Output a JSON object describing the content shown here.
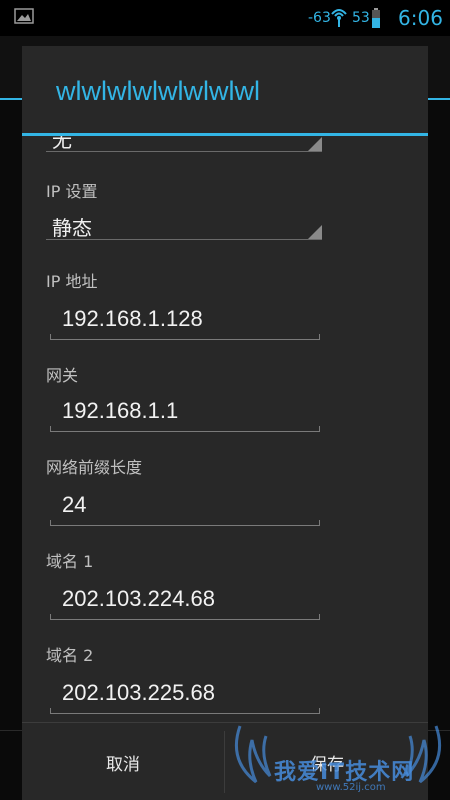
{
  "status_bar": {
    "signal": "-63",
    "battery": "53",
    "time": "6:06",
    "icons": [
      "image-icon",
      "wifi-icon",
      "battery-icon"
    ]
  },
  "dialog": {
    "title": "wlwlwlwlwlwlwlwl",
    "proxy_value": "无",
    "ip_settings_label": "IP 设置",
    "ip_settings_value": "静态",
    "ip_address_label": "IP 地址",
    "ip_address_value": "192.168.1.128",
    "gateway_label": "网关",
    "gateway_value": "192.168.1.1",
    "prefix_label": "网络前缀长度",
    "prefix_value": "24",
    "dns1_label": "域名 1",
    "dns1_value": "202.103.224.68",
    "dns2_label": "域名 2",
    "dns2_value": "202.103.225.68",
    "cancel_label": "取消",
    "save_label": "保存"
  },
  "watermark": {
    "text": "我爱IT技术网",
    "url": "www.52ij.com"
  },
  "colors": {
    "accent": "#33b5e5",
    "dialog_bg": "#282828",
    "text": "#f0f0f0"
  }
}
